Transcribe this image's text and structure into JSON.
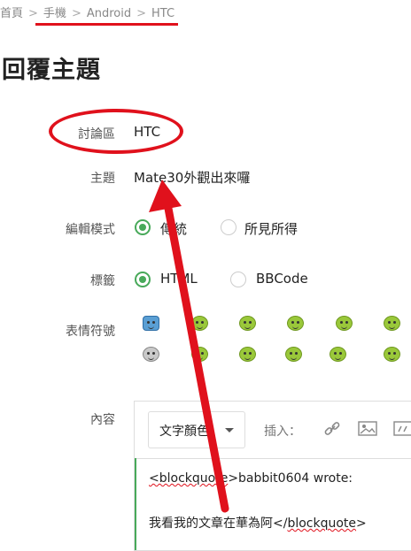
{
  "breadcrumb": {
    "items": [
      "首頁",
      "手機",
      "Android",
      "HTC"
    ],
    "separator": ">"
  },
  "page_title": "回覆主題",
  "form": {
    "forum_label": "討論區",
    "forum_value": "HTC",
    "subject_label": "主題",
    "subject_value": "Mate30外觀出來囉",
    "mode_label": "編輯模式",
    "mode_options": [
      "傳統",
      "所見所得"
    ],
    "mode_selected": "傳統",
    "tag_label": "標籤",
    "tag_options": [
      "HTML",
      "BBCode"
    ],
    "tag_selected": "HTML",
    "emoticon_label": "表情符號",
    "content_label": "內容"
  },
  "editor": {
    "color_select": "文字顏色",
    "insert_label": "插入：",
    "toolbar_icons": [
      "link-icon",
      "image-icon",
      "media-icon"
    ],
    "lines": {
      "l1_tag": "<blockquote",
      "l1_rest": ">babbit0604 wrote:",
      "l2_text": "我看我的文章在華為阿</",
      "l2_tag": "blockquote",
      "l2_end": ">"
    }
  },
  "emoticons": [
    "cup-emoticon",
    "happy-emoticon",
    "shout-emoticon",
    "grin-emoticon",
    "laugh-emoticon",
    "sweat-emoticon",
    "money-emoticon",
    "smile-emoticon",
    "wink-emoticon",
    "cheer-emoticon",
    "music-emoticon",
    "angry-emoticon"
  ],
  "annotation_colors": {
    "red": "#e0111c",
    "green": "#48a95a"
  }
}
